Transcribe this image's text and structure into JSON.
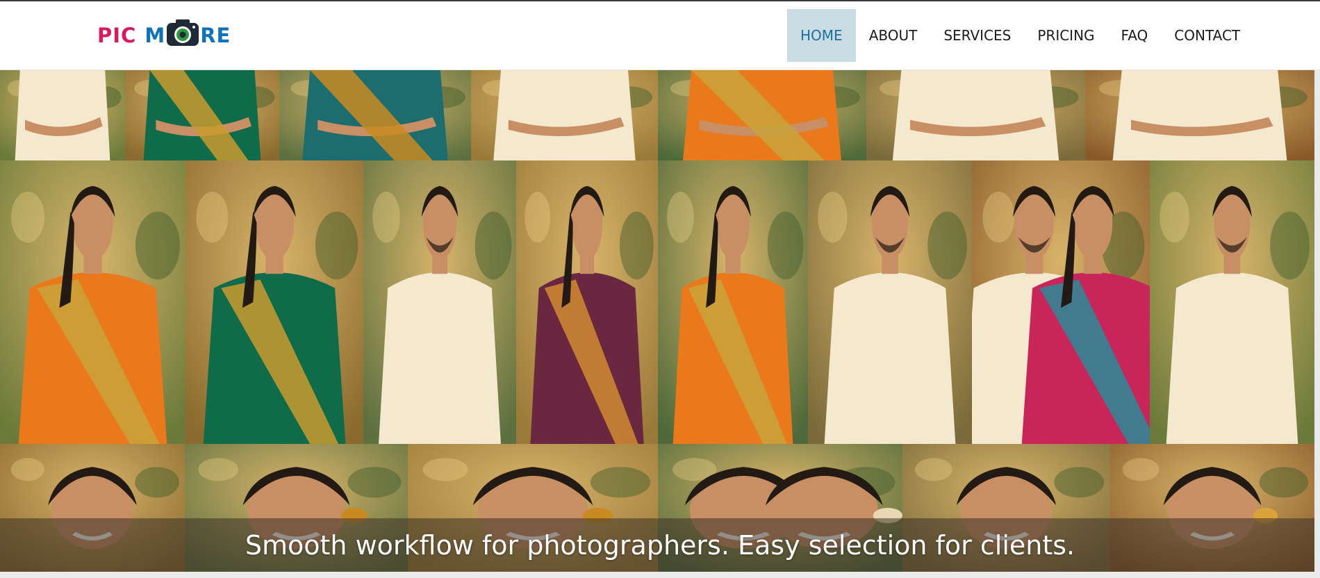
{
  "brand": {
    "part1": "PIC",
    "part2": "M",
    "part3": "RE",
    "icon": "camera-icon",
    "colors": {
      "pic": "#d81b60",
      "more": "#1172b8",
      "lens": "#2e9a3c"
    }
  },
  "nav": {
    "items": [
      {
        "label": "HOME",
        "active": true
      },
      {
        "label": "ABOUT",
        "active": false
      },
      {
        "label": "SERVICES",
        "active": false
      },
      {
        "label": "PRICING",
        "active": false
      },
      {
        "label": "FAQ",
        "active": false
      },
      {
        "label": "CONTACT",
        "active": false
      }
    ],
    "active_bg": "#c9dce4",
    "active_color": "#1d6f9b"
  },
  "hero": {
    "tagline": "Smooth workflow for photographers. Easy selection for clients.",
    "photos": [
      {
        "subject": "man",
        "attire": "cream"
      },
      {
        "subject": "woman",
        "attire": "green-saree"
      },
      {
        "subject": "woman",
        "attire": "teal-saree"
      },
      {
        "subject": "man",
        "attire": "cream"
      },
      {
        "subject": "woman",
        "attire": "orange-saree"
      },
      {
        "subject": "man",
        "attire": "cream"
      },
      {
        "subject": "man",
        "attire": "cream"
      },
      {
        "subject": "woman",
        "attire": "orange-saree"
      },
      {
        "subject": "woman",
        "attire": "green-saree"
      },
      {
        "subject": "man",
        "attire": "cream"
      },
      {
        "subject": "woman",
        "attire": "maroon-saree"
      },
      {
        "subject": "woman",
        "attire": "orange-saree"
      },
      {
        "subject": "man",
        "attire": "cream"
      },
      {
        "subject": "couple",
        "attire": "pink-saree"
      },
      {
        "subject": "man",
        "attire": "cream"
      },
      {
        "subject": "man",
        "attire": "cream"
      },
      {
        "subject": "woman",
        "attire": "earrings"
      },
      {
        "subject": "woman",
        "attire": "jasmine"
      },
      {
        "subject": "couple",
        "attire": "cream"
      },
      {
        "subject": "man",
        "attire": "cream"
      },
      {
        "subject": "woman",
        "attire": "red"
      }
    ]
  }
}
